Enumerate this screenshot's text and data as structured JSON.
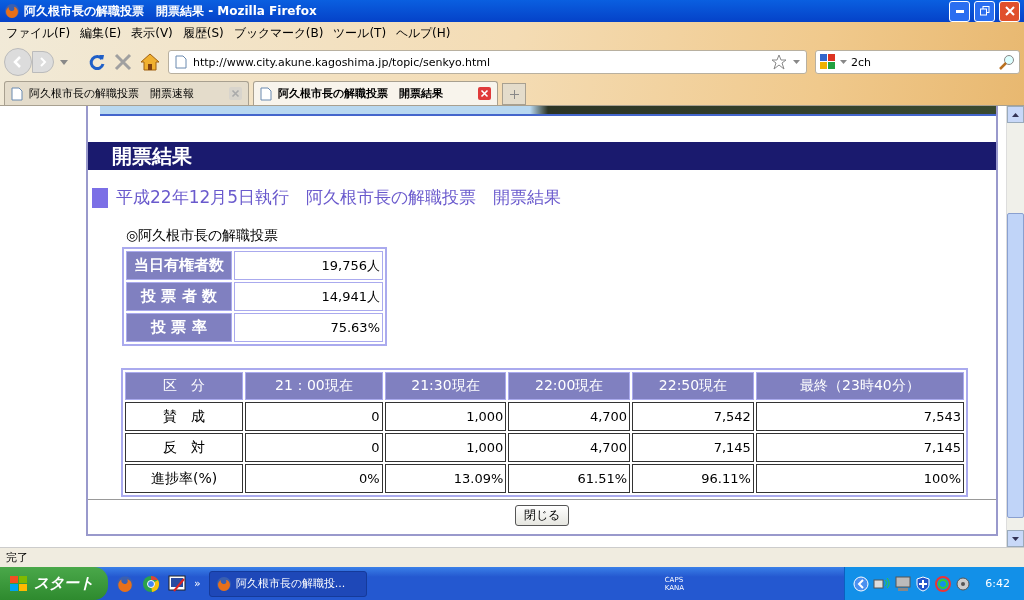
{
  "window": {
    "title": "阿久根市長の解職投票　開票結果 - Mozilla Firefox"
  },
  "menu": [
    "ファイル(F)",
    "編集(E)",
    "表示(V)",
    "履歴(S)",
    "ブックマーク(B)",
    "ツール(T)",
    "ヘルプ(H)"
  ],
  "address": {
    "value": "http://www.city.akune.kagoshima.jp/topic/senkyo.html"
  },
  "search": {
    "value": "2ch"
  },
  "tabs": [
    {
      "label": "阿久根市長の解職投票　開票速報",
      "selected": false
    },
    {
      "label": "阿久根市長の解職投票　開票結果",
      "selected": true
    }
  ],
  "page": {
    "header": "開票結果",
    "subtitle": "平成22年12月5日執行　阿久根市長の解職投票　開票結果",
    "section": "◎阿久根市長の解職投票",
    "summary": [
      {
        "label": "当日有権者数",
        "value": "19,756人"
      },
      {
        "label": "投 票 者 数",
        "value": "14,941人"
      },
      {
        "label": "投 票 率",
        "value": "75.63%"
      }
    ],
    "table": {
      "columns": [
        "区　分",
        "21：00現在",
        "21:30現在",
        "22:00現在",
        "22:50現在",
        "最終（23時40分）"
      ],
      "rows": [
        [
          "賛　成",
          "0",
          "1,000",
          "4,700",
          "7,542",
          "7,543"
        ],
        [
          "反　対",
          "0",
          "1,000",
          "4,700",
          "7,145",
          "7,145"
        ],
        [
          "進捗率(%)",
          "0%",
          "13.09%",
          "61.51%",
          "96.11%",
          "100%"
        ]
      ]
    },
    "close_button": "閉じる"
  },
  "status_bar": "完了",
  "taskbar": {
    "start": "スタート",
    "chevron": "»",
    "task": "阿久根市長の解職投...",
    "indicators": [
      "CAPS",
      "KANA"
    ],
    "clock": "6:42"
  }
}
